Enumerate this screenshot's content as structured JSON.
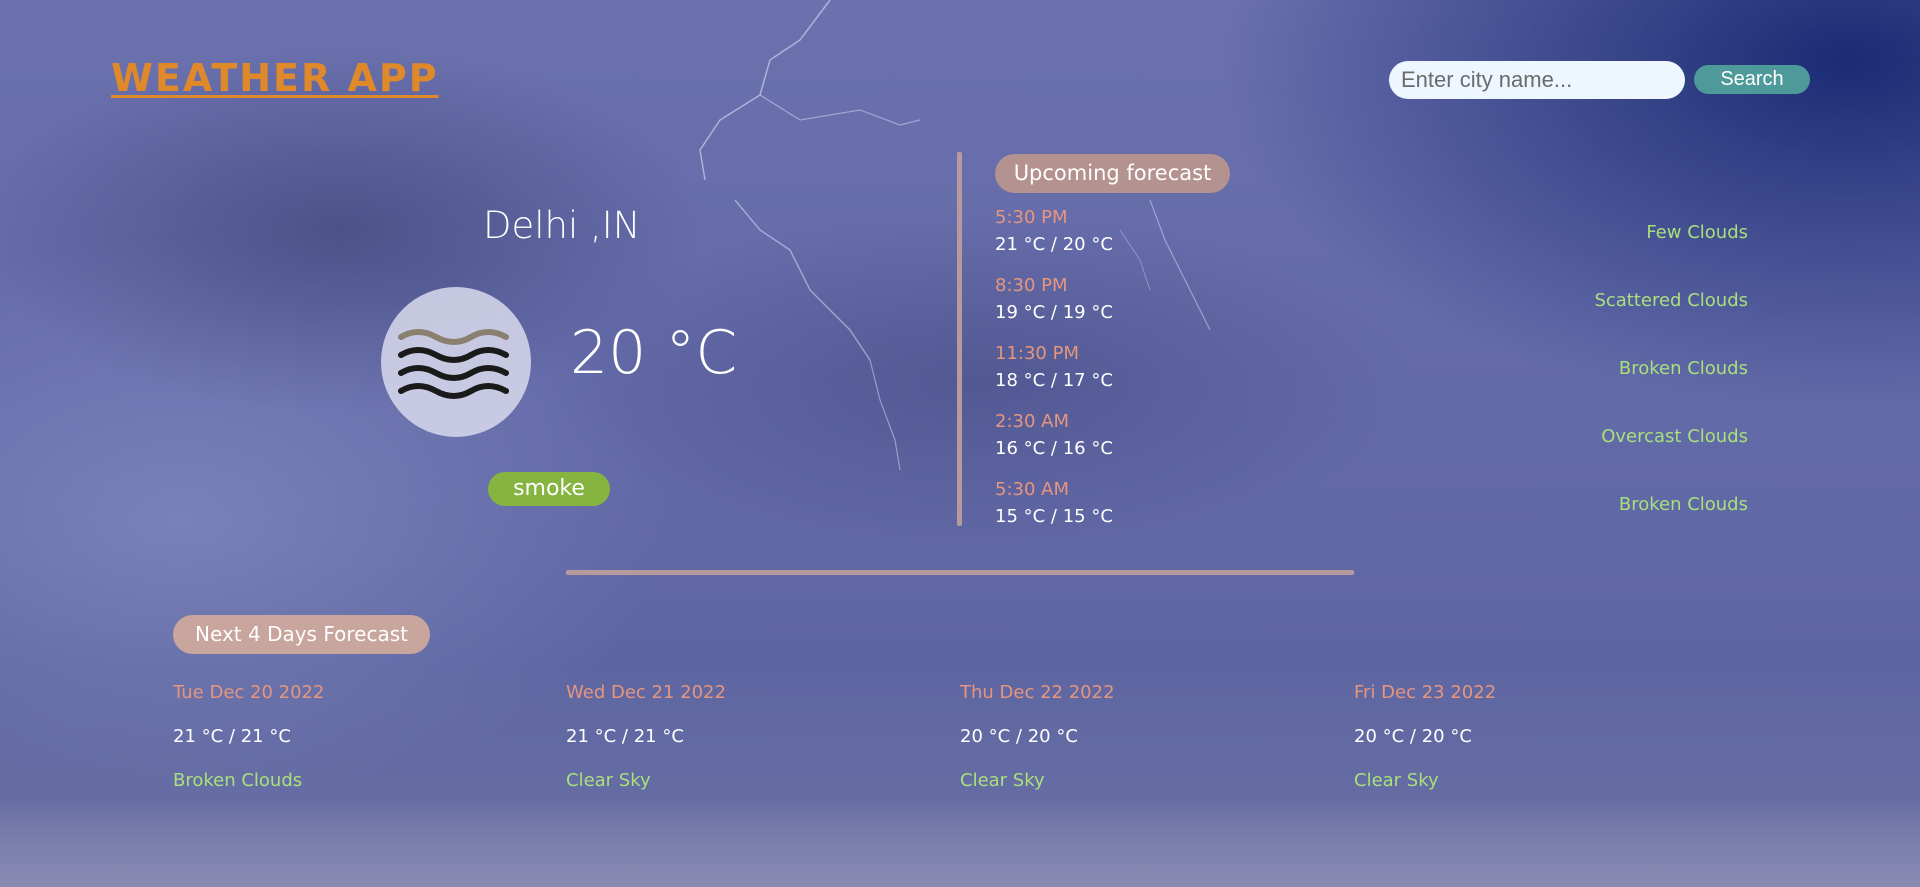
{
  "header": {
    "logo": "WEATHER APP",
    "search_placeholder": "Enter city name...",
    "search_value": "",
    "search_label": "Search"
  },
  "current": {
    "city": "Delhi ,IN",
    "temperature": "20 °C",
    "condition": "smoke",
    "icon": "mist-icon"
  },
  "upcoming": {
    "title": "Upcoming forecast",
    "items": [
      {
        "time": "5:30 PM",
        "temp": "21 °C / 20 °C",
        "desc": "Few Clouds"
      },
      {
        "time": "8:30 PM",
        "temp": "19 °C / 19 °C",
        "desc": "Scattered Clouds"
      },
      {
        "time": "11:30 PM",
        "temp": "18 °C / 17 °C",
        "desc": "Broken Clouds"
      },
      {
        "time": "2:30 AM",
        "temp": "16 °C / 16 °C",
        "desc": "Overcast Clouds"
      },
      {
        "time": "5:30 AM",
        "temp": "15 °C / 15 °C",
        "desc": "Broken Clouds"
      }
    ]
  },
  "days": {
    "title": "Next 4 Days Forecast",
    "items": [
      {
        "date": "Tue Dec 20 2022",
        "temp": "21 °C / 21 °C",
        "desc": "Broken Clouds"
      },
      {
        "date": "Wed Dec 21 2022",
        "temp": "21 °C / 21 °C",
        "desc": "Clear Sky"
      },
      {
        "date": "Thu Dec 22 2022",
        "temp": "20 °C / 20 °C",
        "desc": "Clear Sky"
      },
      {
        "date": "Fri Dec 23 2022",
        "temp": "20 °C / 20 °C",
        "desc": "Clear Sky"
      }
    ]
  },
  "colors": {
    "logo": "#e0892b",
    "time_text": "#e6967e",
    "desc_text": "#a8e07c",
    "search_button": "#4e9a9b",
    "condition_pill": "#86b440",
    "section_pill": "#b3928f",
    "divider": "#b59a9e"
  }
}
